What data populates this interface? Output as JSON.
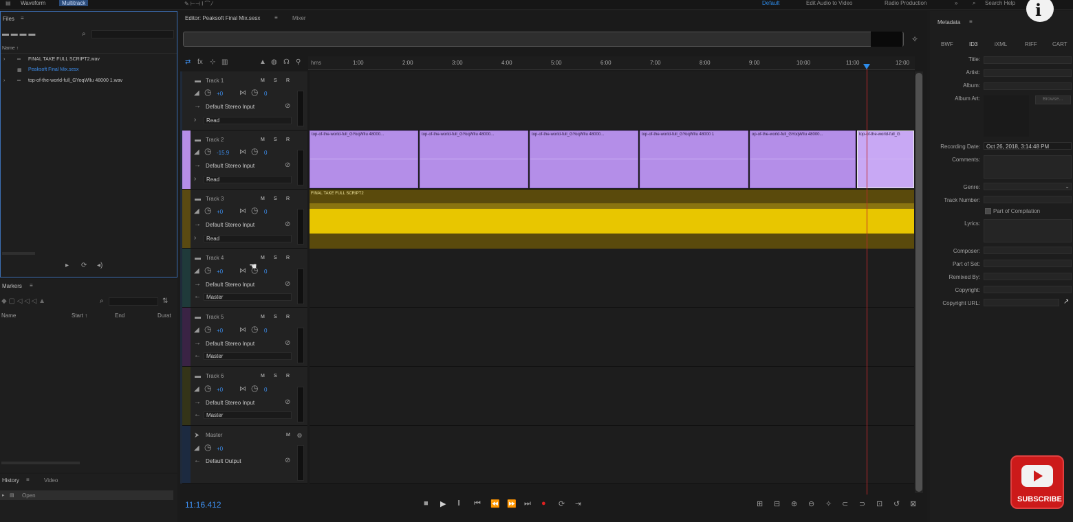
{
  "topbar": {
    "workspace_waveform": "Waveform",
    "workspace_multitrack": "Multitrack",
    "ws_default": "Default",
    "ws_edit_video": "Edit Audio to Video",
    "ws_radio": "Radio Production",
    "search_help": "Search Help",
    "more": "»"
  },
  "files": {
    "title": "Files",
    "col_name": "Name ↑",
    "items": [
      "FINAL TAKE FULL SCRIPT2.wav",
      "Peaksoft Final Mix.sesx",
      "top-of-the-world-full_GYoqWlIu 48000 1.wav"
    ]
  },
  "markers": {
    "title": "Markers",
    "col_name": "Name",
    "col_start": "Start ↑",
    "col_end": "End",
    "col_duration": "Durat"
  },
  "history": {
    "tab_history": "History",
    "tab_video": "Video",
    "item_open": "Open"
  },
  "editor": {
    "tab_editor": "Editor: Peaksoft Final Mix.sesx",
    "tab_mixer": "Mixer",
    "time_display": "11:16.412",
    "ruler_unit": "hms",
    "ruler_ticks": [
      "1:00",
      "2:00",
      "3:00",
      "4:00",
      "5:00",
      "6:00",
      "7:00",
      "8:00",
      "9:00",
      "10:00",
      "11:00",
      "12:00"
    ]
  },
  "tracks": [
    {
      "name": "Track 1",
      "volume": "+0",
      "pan": "0",
      "input": "Default Stereo Input",
      "mode": "Read"
    },
    {
      "name": "Track 2",
      "volume": "-15.9",
      "pan": "0",
      "input": "Default Stereo Input",
      "mode": "Read"
    },
    {
      "name": "Track 3",
      "volume": "+0",
      "pan": "0",
      "input": "Default Stereo Input",
      "mode": "Read"
    },
    {
      "name": "Track 4",
      "volume": "+0",
      "pan": "0",
      "input": "Default Stereo Input",
      "mode": "Master"
    },
    {
      "name": "Track 5",
      "volume": "+0",
      "pan": "0",
      "input": "Default Stereo Input",
      "mode": "Master"
    },
    {
      "name": "Track 6",
      "volume": "+0",
      "pan": "0",
      "input": "Default Stereo Input",
      "mode": "Master"
    },
    {
      "name": "Master",
      "volume": "+0",
      "pan": "",
      "input": "Default Output",
      "mode": ""
    }
  ],
  "track_buttons": {
    "m": "M",
    "s": "S",
    "r": "R"
  },
  "clips": {
    "track2": [
      "top-of-the-world-full_GYoqWlIu 48000...",
      "top-of-the-world-full_GYoqWlIu 48000...",
      "top-of-the-world-full_GYoqWlIu 48000...",
      "top-of-the-world-full_GYoqWlIu 48000 1",
      "op-of-the-world-full_GYoqWlIu 48000...",
      "top-of-the-world-full_G"
    ],
    "track3": "FINAL TAKE FULL SCRIPT2"
  },
  "metadata": {
    "title": "Metadata",
    "tabs": [
      "BWF",
      "ID3",
      "iXML",
      "RIFF",
      "CART"
    ],
    "fields": {
      "title": "Title:",
      "artist": "Artist:",
      "album": "Album:",
      "album_art": "Album Art:",
      "browse": "Browse...",
      "recording_date": "Recording Date:",
      "recording_date_value": "Oct 26, 2018, 3:14:48 PM",
      "comments": "Comments:",
      "genre": "Genre:",
      "track_number": "Track Number:",
      "part_of_compilation": "Part of Compilation",
      "lyrics": "Lyrics:",
      "composer": "Composer:",
      "part_of_set": "Part of Set:",
      "remixed_by": "Remixed By:",
      "copyright": "Copyright:",
      "copyright_url": "Copyright URL:"
    }
  },
  "overlay": {
    "subscribe": "SUBSCRIBE",
    "info": "i"
  },
  "colors": {
    "track2_clip": "#b48ee8",
    "track3_clip": "#e8c600",
    "playhead": "#c0282a",
    "accent_blue": "#2d8ceb"
  }
}
